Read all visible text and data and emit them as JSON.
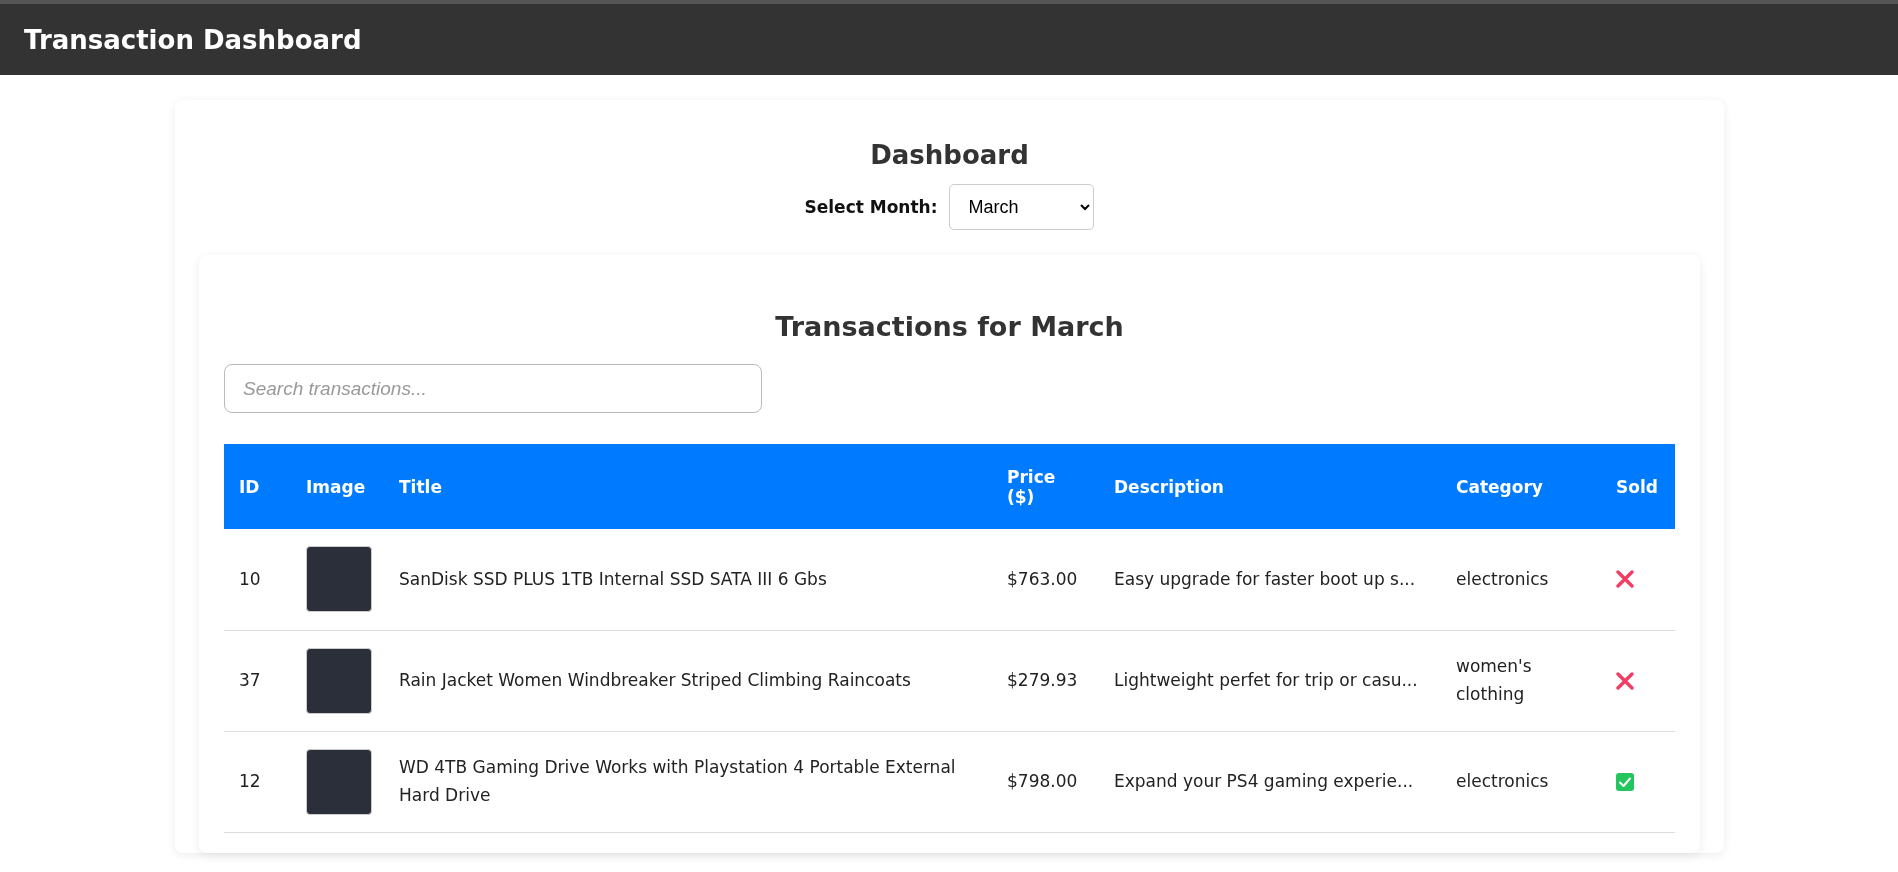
{
  "header": {
    "title": "Transaction Dashboard"
  },
  "dashboard": {
    "heading": "Dashboard",
    "month_label": "Select Month:",
    "month_value": "March"
  },
  "transactions": {
    "heading": "Transactions for March",
    "search": {
      "placeholder": "Search transactions..."
    },
    "table": {
      "columns": [
        "ID",
        "Image",
        "Title",
        "Price ($)",
        "Description",
        "Category",
        "Sold"
      ],
      "rows": [
        {
          "id": "10",
          "title": "SanDisk SSD PLUS 1TB Internal SSD SATA III 6 Gbs",
          "price": "$763.00",
          "description": "Easy upgrade for faster boot up s...",
          "category": "electronics",
          "sold": false
        },
        {
          "id": "37",
          "title": "Rain Jacket Women Windbreaker Striped Climbing Raincoats",
          "price": "$279.93",
          "description": "Lightweight perfet for trip or casu...",
          "category": "women's clothing",
          "sold": false
        },
        {
          "id": "12",
          "title": "WD 4TB Gaming Drive Works with Playstation 4 Portable External Hard Drive",
          "price": "$798.00",
          "description": "Expand your PS4 gaming experie...",
          "category": "electronics",
          "sold": true
        }
      ]
    }
  }
}
